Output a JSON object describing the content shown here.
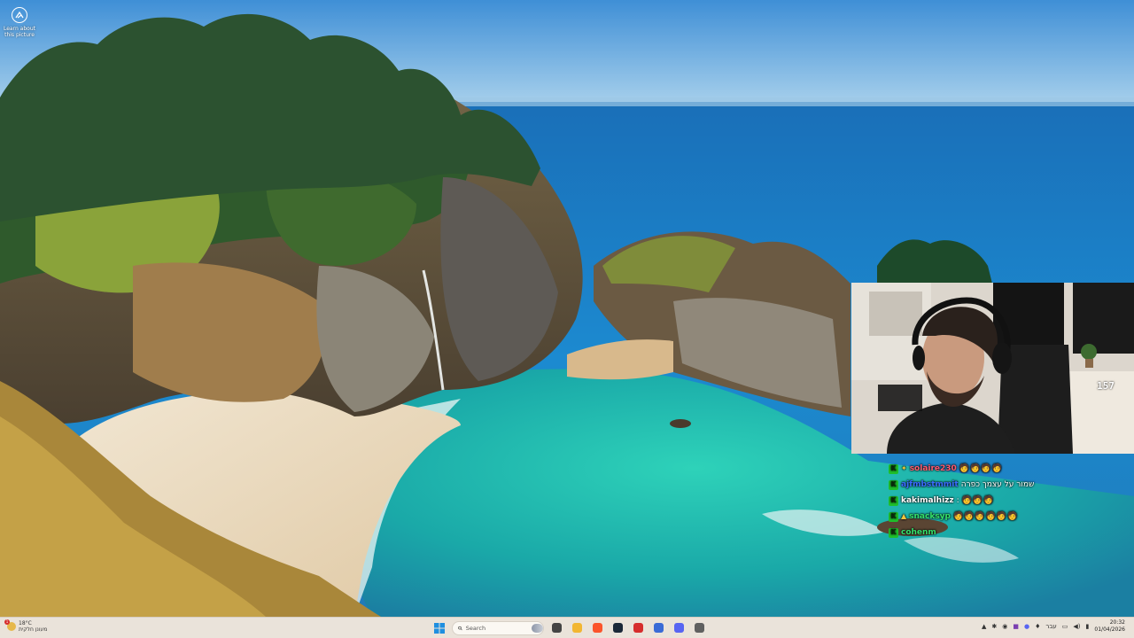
{
  "desktop": {
    "learn_picture": {
      "label": "Learn about this picture",
      "icon": "camera-aperture-icon"
    }
  },
  "webcam": {
    "badge_text": "157"
  },
  "chat": {
    "messages": [
      {
        "user": "solaire230",
        "user_color": "#ff5a6e",
        "extra": "✦",
        "extra_color": "#f0c43c",
        "text": "",
        "emotes": "🧑🧑🧑🧑"
      },
      {
        "user": "ajfmbstmmit",
        "user_color": "#3a6bff",
        "extra": "",
        "extra_color": "",
        "text": "שמור על עצמך כפרה",
        "emotes": ""
      },
      {
        "user": "kakimalhizz",
        "user_color": "#ffffff",
        "extra": "",
        "extra_color": "",
        "text": ":",
        "emotes": "🧑🧑🧑"
      },
      {
        "user": "snacksyp",
        "user_color": "#35e06a",
        "extra": "▲",
        "extra_color": "#f0c43c",
        "text": "",
        "emotes": "🧑🧑🧑🧑🧑🧑"
      },
      {
        "user": "cohenm",
        "user_color": "#35e06a",
        "extra": "",
        "extra_color": "",
        "text": "",
        "emotes": ""
      }
    ]
  },
  "taskbar": {
    "weather": {
      "temp": "18°C",
      "desc": "מעונן חלקית",
      "notification_count": "1"
    },
    "start_icon": "windows-start-icon",
    "search": {
      "placeholder": "Search"
    },
    "pinned_apps": [
      {
        "name": "task-view-icon",
        "color": "#444444"
      },
      {
        "name": "file-explorer-icon",
        "color": "#f2b632"
      },
      {
        "name": "brave-browser-icon",
        "color": "#fb542b"
      },
      {
        "name": "steam-icon",
        "color": "#1b2838"
      },
      {
        "name": "obs-record-icon",
        "color": "#d62d2d"
      },
      {
        "name": "chatgpt-icon",
        "color": "#3a6bd6"
      },
      {
        "name": "discord-icon",
        "color": "#5865f2"
      },
      {
        "name": "settings-gear-icon",
        "color": "#606060"
      }
    ],
    "tray": {
      "language": "עבר",
      "time": "20:32",
      "date": "01/04/2026"
    }
  }
}
